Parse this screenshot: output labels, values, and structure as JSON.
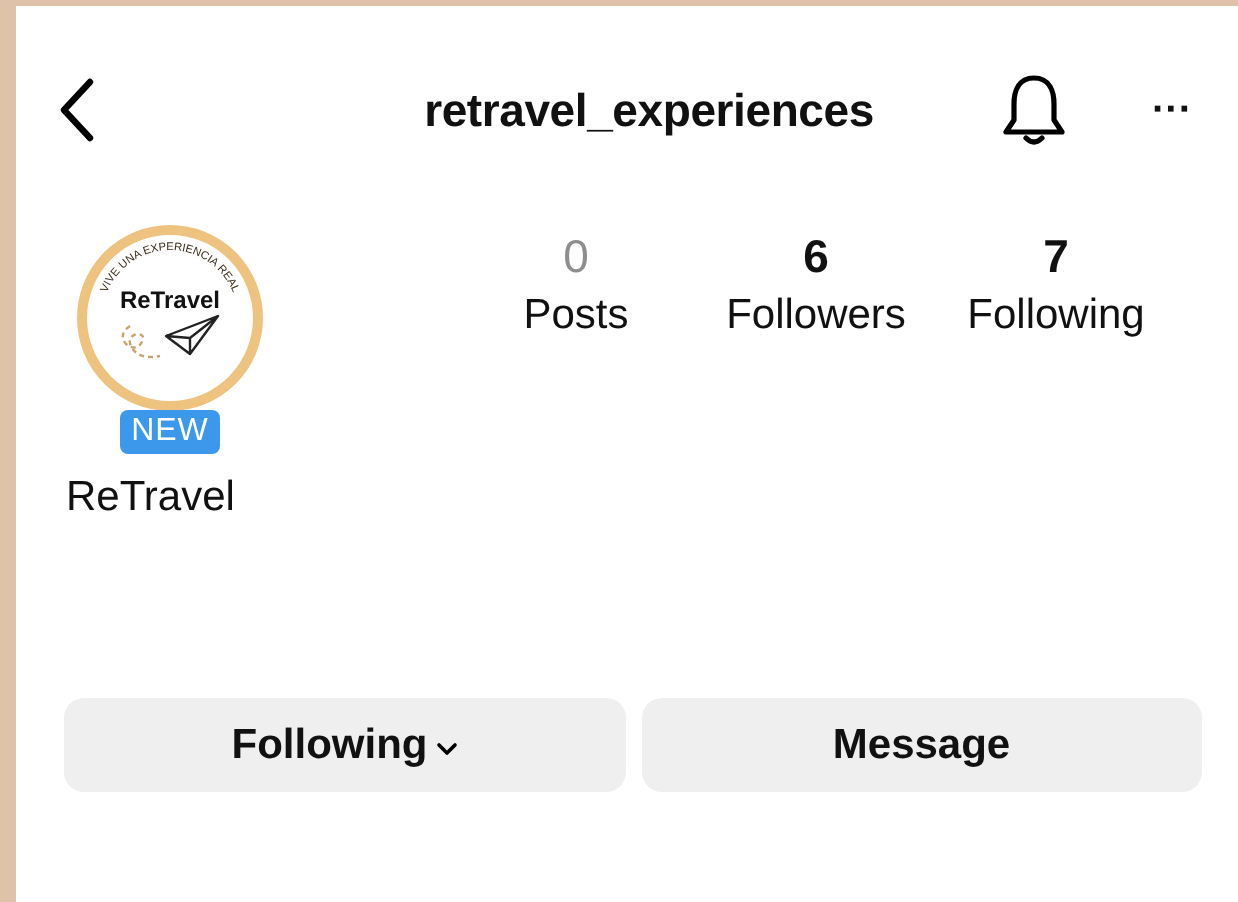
{
  "header": {
    "username": "retravel_experiences",
    "more": "···"
  },
  "profile": {
    "logo_text": "ReTravel",
    "logo_tagline": "VIVE UNA EXPERIENCIA REAL",
    "badge": "NEW",
    "name": "ReTravel"
  },
  "stats": [
    {
      "value": "0",
      "label": "Posts",
      "muted": true
    },
    {
      "value": "6",
      "label": "Followers",
      "muted": false
    },
    {
      "value": "7",
      "label": "Following",
      "muted": false
    }
  ],
  "buttons": [
    {
      "label": "Following",
      "kind": "dropdown"
    },
    {
      "label": "Message",
      "kind": "plain"
    }
  ]
}
